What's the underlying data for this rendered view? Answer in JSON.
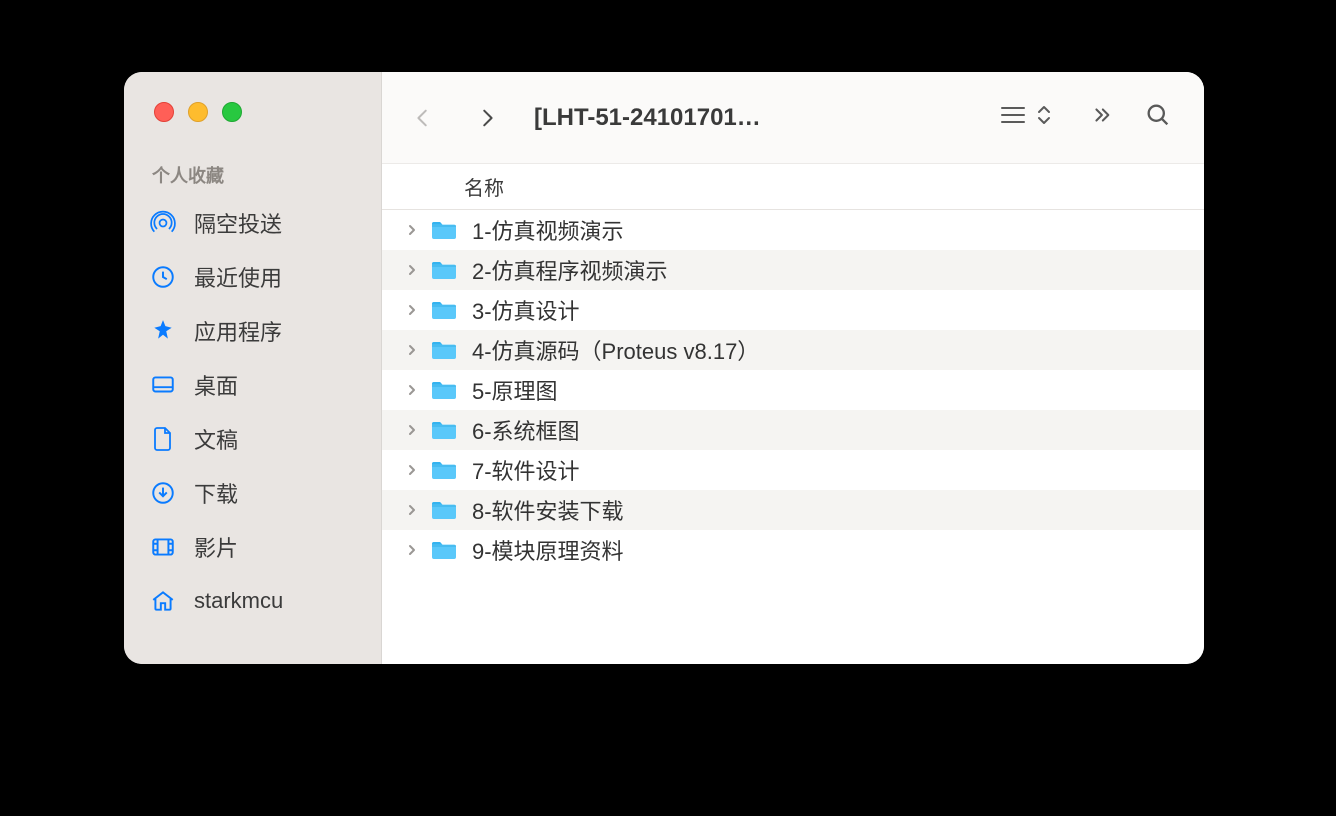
{
  "window": {
    "title": "[LHT-51-24101701…"
  },
  "sidebar": {
    "section": "个人收藏",
    "items": [
      {
        "icon": "airdrop",
        "label": "隔空投送"
      },
      {
        "icon": "clock",
        "label": "最近使用"
      },
      {
        "icon": "apps",
        "label": "应用程序"
      },
      {
        "icon": "desktop",
        "label": "桌面"
      },
      {
        "icon": "doc",
        "label": "文稿"
      },
      {
        "icon": "download",
        "label": "下载"
      },
      {
        "icon": "film",
        "label": "影片"
      },
      {
        "icon": "home",
        "label": "starkmcu"
      }
    ]
  },
  "columns": {
    "name": "名称"
  },
  "rows": [
    {
      "name": "1-仿真视频演示"
    },
    {
      "name": "2-仿真程序视频演示"
    },
    {
      "name": "3-仿真设计"
    },
    {
      "name": "4-仿真源码（Proteus v8.17）"
    },
    {
      "name": "5-原理图"
    },
    {
      "name": "6-系统框图"
    },
    {
      "name": "7-软件设计"
    },
    {
      "name": "8-软件安装下载"
    },
    {
      "name": "9-模块原理资料"
    }
  ]
}
